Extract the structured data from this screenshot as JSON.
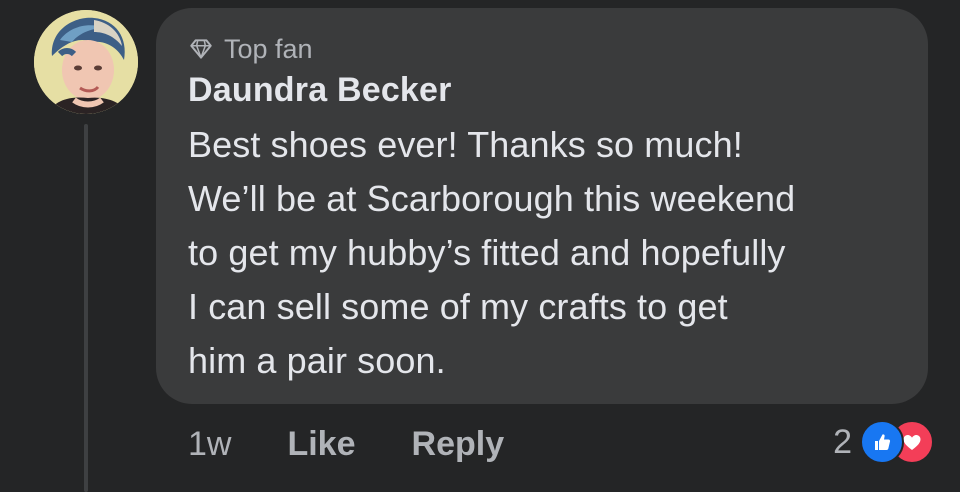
{
  "comment": {
    "badge": "Top fan",
    "author": "Daundra Becker",
    "text": "Best shoes ever! Thanks so much!\nWe’ll be at Scarborough this weekend\nto get my hubby’s fitted and hopefully\nI can sell some of my crafts to get\nhim a pair soon."
  },
  "actions": {
    "time": "1w",
    "like_label": "Like",
    "reply_label": "Reply"
  },
  "reactions": {
    "count": "2",
    "types": [
      "like-icon",
      "love-icon"
    ],
    "like_color": "#1877f2",
    "love_color": "#f33e58"
  },
  "colors": {
    "background": "#242526",
    "bubble": "#3a3b3c",
    "primary_text": "#e4e6eb",
    "secondary_text": "#b0b3b8"
  }
}
